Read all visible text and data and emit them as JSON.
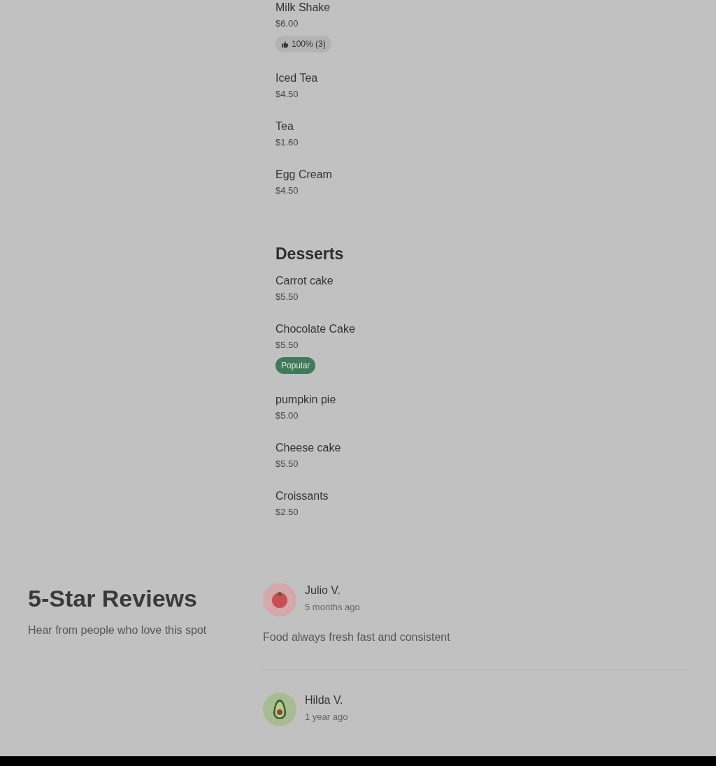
{
  "menu_sections": [
    {
      "items": [
        {
          "name": "Milk Shake",
          "price": "$6.00",
          "badge": {
            "kind": "rating",
            "text": "100% (3)"
          }
        },
        {
          "name": "Iced Tea",
          "price": "$4.50"
        },
        {
          "name": "Tea",
          "price": "$1.60"
        },
        {
          "name": "Egg Cream",
          "price": "$4.50"
        }
      ]
    },
    {
      "title": "Desserts",
      "items": [
        {
          "name": "Carrot cake",
          "price": "$5.50"
        },
        {
          "name": "Chocolate Cake",
          "price": "$5.50",
          "badge": {
            "kind": "popular",
            "text": "Popular"
          }
        },
        {
          "name": "pumpkin pie",
          "price": "$5.00"
        },
        {
          "name": "Cheese cake",
          "price": "$5.50"
        },
        {
          "name": "Croissants",
          "price": "$2.50"
        }
      ]
    }
  ],
  "reviews": {
    "title": "5-Star Reviews",
    "subtitle": "Hear from people who love this spot",
    "items": [
      {
        "kind": "tomato",
        "name": "Julio V.",
        "time": "5 months ago",
        "text": "Food always fresh fast and consistent"
      },
      {
        "kind": "avocado",
        "name": "Hilda V.",
        "time": "1 year ago"
      }
    ]
  }
}
